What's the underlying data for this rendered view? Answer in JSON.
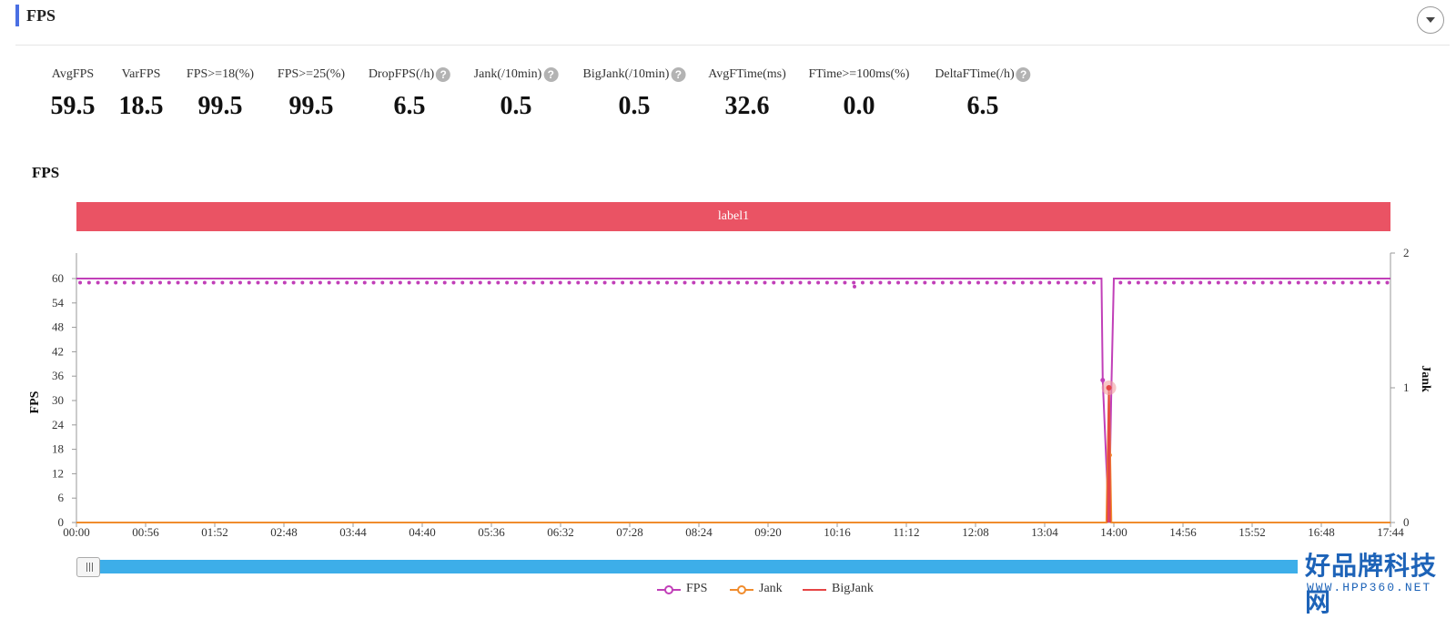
{
  "panel": {
    "title": "FPS"
  },
  "metrics": [
    {
      "label": "AvgFPS",
      "value": "59.5",
      "help": false
    },
    {
      "label": "VarFPS",
      "value": "18.5",
      "help": false
    },
    {
      "label": "FPS>=18(%)",
      "value": "99.5",
      "help": false
    },
    {
      "label": "FPS>=25(%)",
      "value": "99.5",
      "help": false
    },
    {
      "label": "DropFPS(/h)",
      "value": "6.5",
      "help": true
    },
    {
      "label": "Jank(/10min)",
      "value": "0.5",
      "help": true
    },
    {
      "label": "BigJank(/10min)",
      "value": "0.5",
      "help": true
    },
    {
      "label": "AvgFTime(ms)",
      "value": "32.6",
      "help": false
    },
    {
      "label": "FTime>=100ms(%)",
      "value": "0.0",
      "help": false
    },
    {
      "label": "DeltaFTime(/h)",
      "value": "6.5",
      "help": true
    }
  ],
  "help_glyph": "?",
  "chart_title": "FPS",
  "label_band": "label1",
  "chart_data": {
    "type": "line",
    "title": "FPS",
    "ylabel": "FPS",
    "y2label": "Jank",
    "ylim": [
      0,
      60
    ],
    "y2lim": [
      0,
      2
    ],
    "yticks": [
      0,
      6,
      12,
      18,
      24,
      30,
      36,
      42,
      48,
      54,
      60
    ],
    "y2ticks": [
      0,
      1,
      2
    ],
    "x_ticks": [
      "00:00",
      "00:56",
      "01:52",
      "02:48",
      "03:44",
      "04:40",
      "05:36",
      "06:32",
      "07:28",
      "08:24",
      "09:20",
      "10:16",
      "11:12",
      "12:08",
      "13:04",
      "14:00",
      "14:56",
      "15:52",
      "16:48",
      "17:44"
    ],
    "x_range_sec": [
      0,
      1064
    ],
    "series": [
      {
        "name": "FPS",
        "axis": "left",
        "color": "#c13fb8",
        "baseline": 60,
        "marker_value": 59,
        "points_sec": [
          [
            830,
            60
          ],
          [
            831,
            35
          ],
          [
            836,
            0
          ],
          [
            838,
            33
          ],
          [
            840,
            60
          ]
        ],
        "low_points": [
          [
            630,
            58
          ]
        ]
      },
      {
        "name": "Jank",
        "axis": "right",
        "color": "#f08c2d",
        "baseline": 0,
        "points_sec": [
          [
            834,
            0
          ],
          [
            836,
            1
          ],
          [
            837,
            0.5
          ],
          [
            838,
            0
          ]
        ]
      },
      {
        "name": "BigJank",
        "axis": "right",
        "color": "#e64545",
        "baseline": 0,
        "points_sec": [
          [
            835,
            0
          ],
          [
            836,
            1
          ],
          [
            837,
            0
          ]
        ]
      }
    ],
    "legend_position": "bottom-center",
    "grid": false
  },
  "legend": [
    {
      "name": "FPS",
      "color": "#c13fb8"
    },
    {
      "name": "Jank",
      "color": "#f08c2d"
    },
    {
      "name": "BigJank",
      "color": "#e64545"
    }
  ],
  "watermark": {
    "main": "好品牌科技网",
    "sub": "WWW.HPP360.NET"
  }
}
